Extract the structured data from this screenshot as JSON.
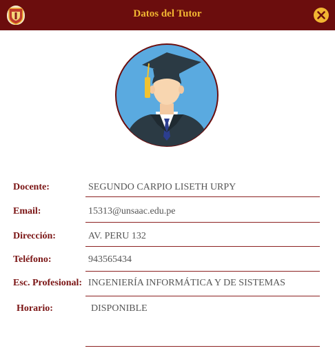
{
  "dialog": {
    "title": "Datos del Tutor",
    "brand_color": "#6b0d0d",
    "title_color": "#f2b632"
  },
  "icons": {
    "logo": "university-seal-icon",
    "close": "close-icon",
    "avatar": "graduate-avatar-icon"
  },
  "fields": [
    {
      "label": "Docente:",
      "value": "SEGUNDO CARPIO LISETH URPY"
    },
    {
      "label": "Email:",
      "value": "15313@unsaac.edu.pe"
    },
    {
      "label": "Dirección:",
      "value": "AV. PERU 132"
    },
    {
      "label": "Teléfono:",
      "value": "943565434"
    },
    {
      "label": "Esc. Profesional:",
      "value": "INGENIERÍA INFORMÁTICA Y DE SISTEMAS"
    },
    {
      "label": "Horario:",
      "value": "DISPONIBLE"
    }
  ]
}
